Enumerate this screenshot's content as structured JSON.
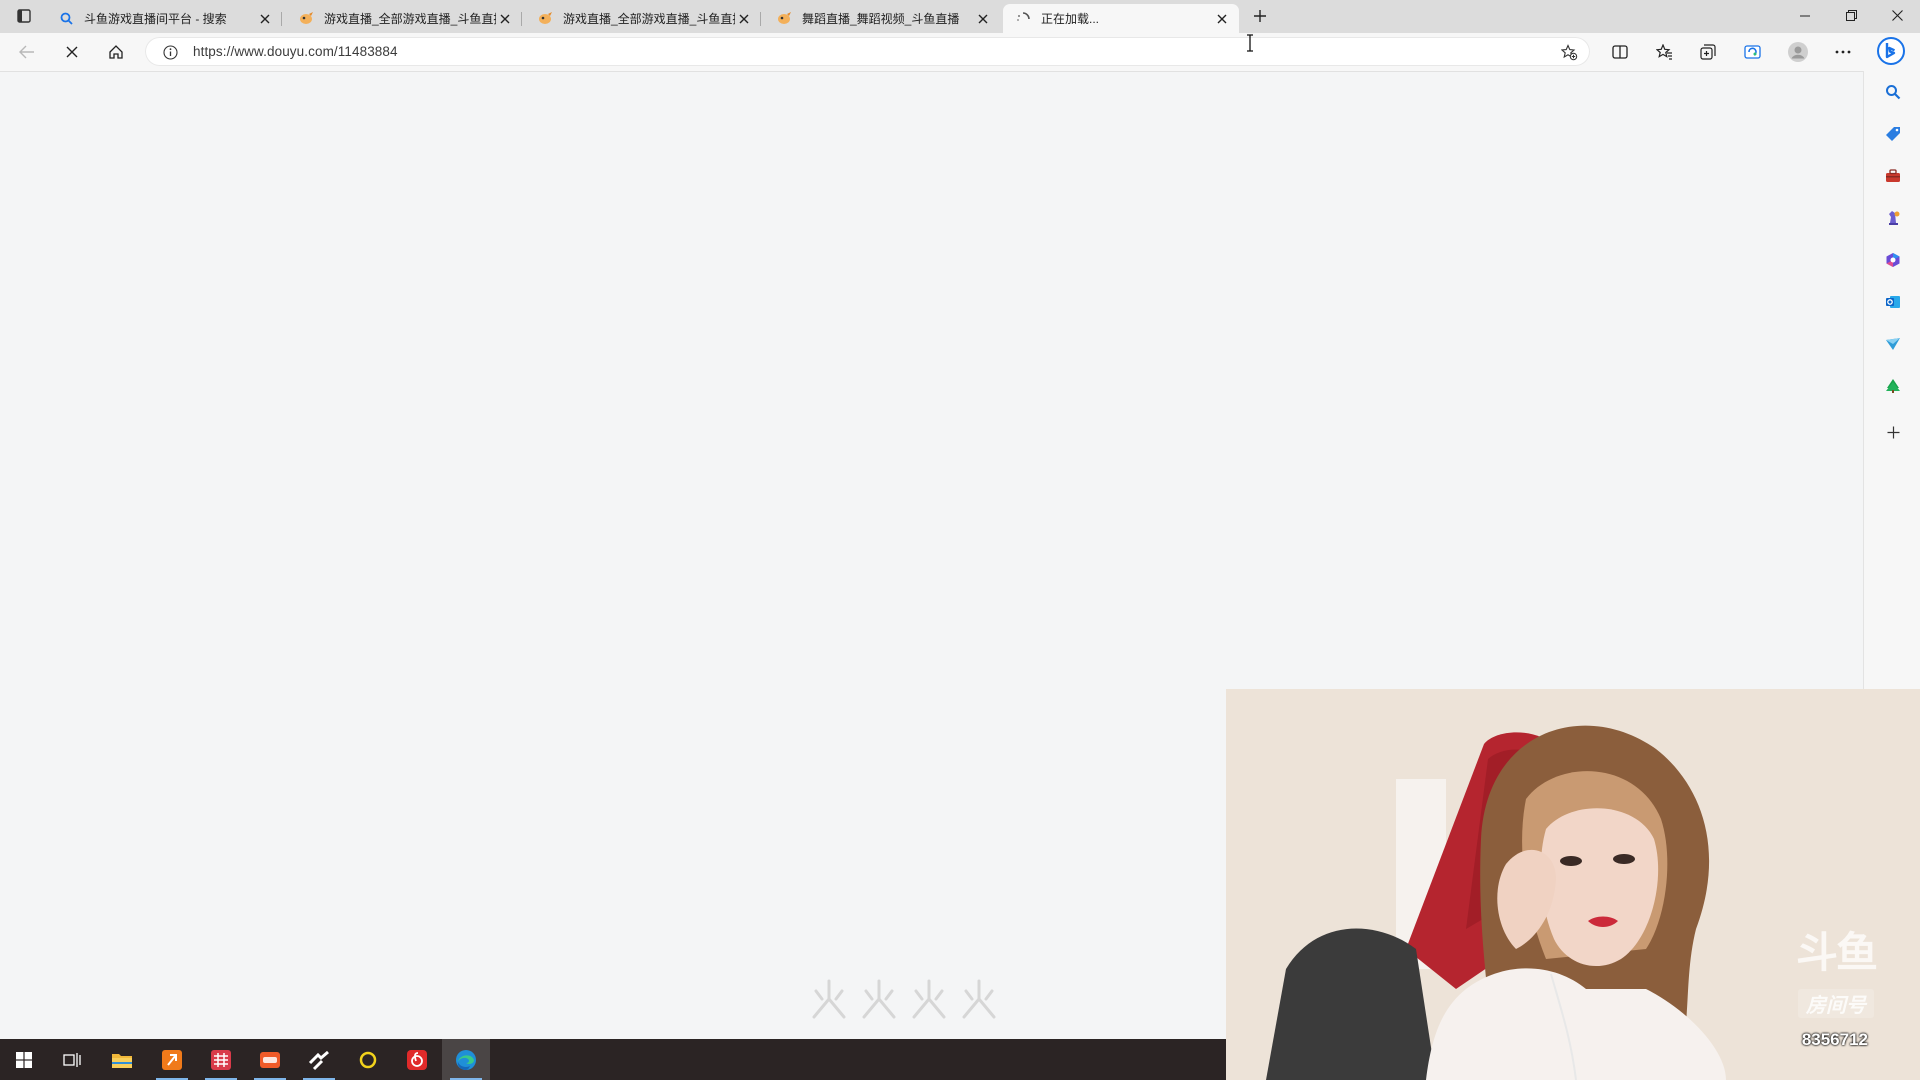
{
  "browser": {
    "tabs": [
      {
        "title": "斗鱼游戏直播间平台 - 搜索",
        "icon": "search-icon"
      },
      {
        "title": "游戏直播_全部游戏直播_斗鱼直播",
        "icon": "douyu-favicon"
      },
      {
        "title": "游戏直播_全部游戏直播_斗鱼直播",
        "icon": "douyu-favicon"
      },
      {
        "title": "舞蹈直播_舞蹈视频_斗鱼直播",
        "icon": "douyu-favicon"
      },
      {
        "title": "正在加载...",
        "icon": "loading-spinner-icon",
        "active": true
      }
    ],
    "address_url": "https://www.douyu.com/11483884",
    "accent_color": "#1a73e8"
  },
  "video": {
    "watermark_logo": "斗鱼",
    "watermark_room": "房间号",
    "watermark_room_id": "8356712"
  },
  "taskbar": {
    "apps": [
      "start-icon",
      "task-view-icon",
      "file-explorer-icon",
      "app-orange-icon",
      "app-red-grid-icon",
      "app-orange-badge-icon",
      "app-arrow-icon",
      "app-yellow-circle-icon",
      "netease-music-icon",
      "edge-icon"
    ],
    "active_app": "edge-icon"
  }
}
